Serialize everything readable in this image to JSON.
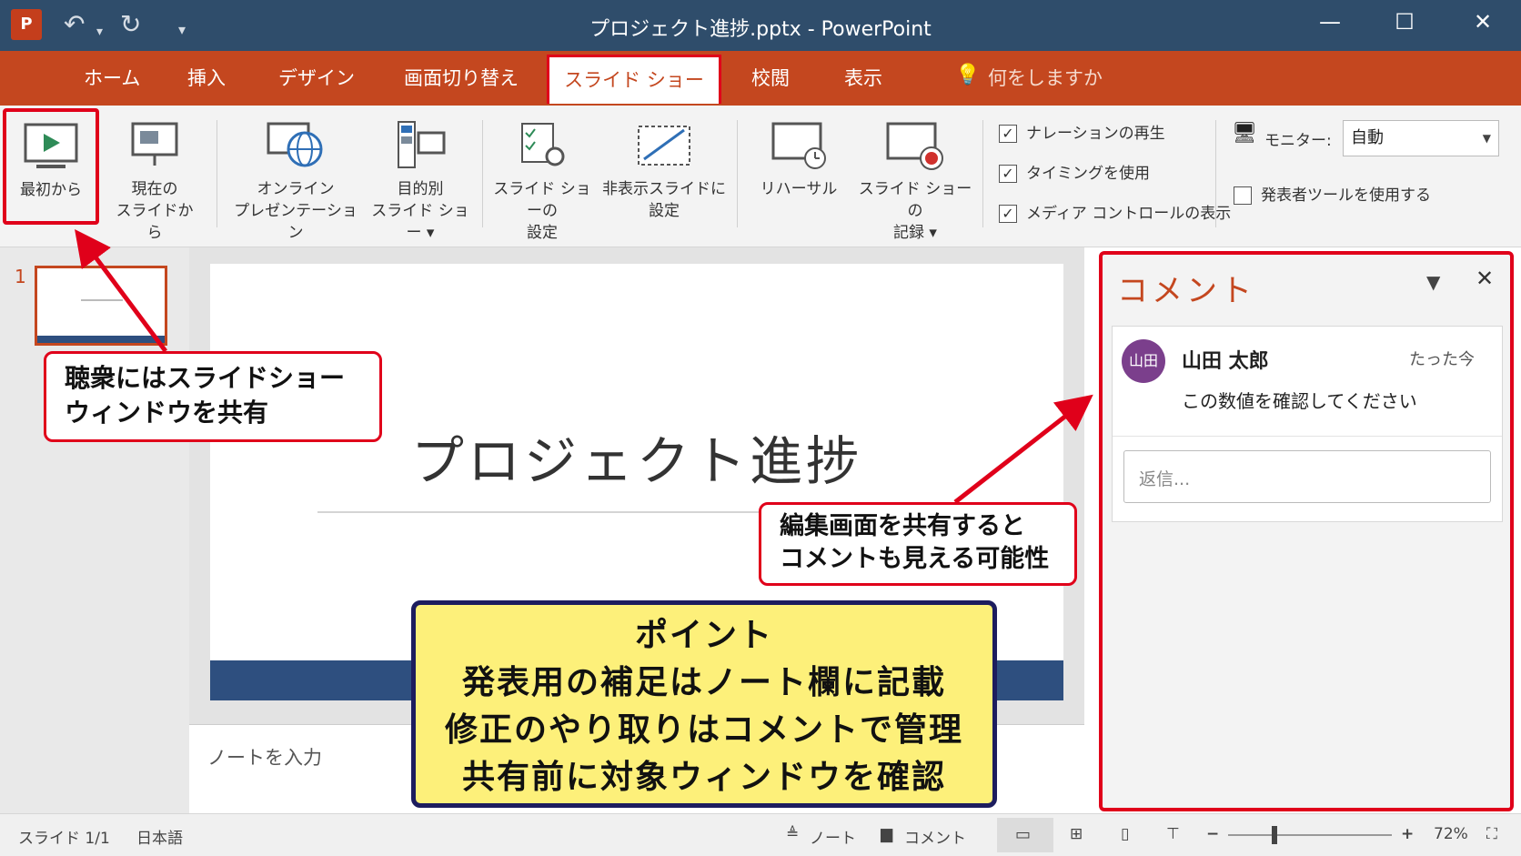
{
  "titlebar": {
    "app_logo": "P",
    "title": "プロジェクト進捗.pptx  -  PowerPoint"
  },
  "tabs": {
    "home": "ホーム",
    "insert": "挿入",
    "design": "デザイン",
    "transitions": "画面切り替え",
    "slideshow": "スライド ショー",
    "review": "校閲",
    "view": "表示",
    "tell_me": "何をしますか"
  },
  "ribbon": {
    "from_beginning": "最初から",
    "from_current_1": "現在の",
    "from_current_2": "スライドから",
    "online_1": "オンライン",
    "online_2": "プレゼンテーション",
    "custom_1": "目的別",
    "custom_2": "スライド ショー ▾",
    "setup_1": "スライド ショーの",
    "setup_2": "設定",
    "hide_1": "非表示スライドに",
    "hide_2": "設定",
    "rehearse": "リハーサル",
    "record_1": "スライド ショーの",
    "record_2": "記録 ▾",
    "play_narrations": "ナレーションの再生",
    "use_timings": "タイミングを使用",
    "show_media_controls": "メディア コントロールの表示",
    "monitor_label": "モニター:",
    "monitor_value": "自動",
    "presenter_view": "発表者ツールを使用する"
  },
  "thumbnail": {
    "number": "1"
  },
  "slide": {
    "title": "プロジェクト進捗"
  },
  "notes": {
    "placeholder": "ノートを入力"
  },
  "comments": {
    "pane_title": "コメント",
    "avatar_initials": "山田",
    "author": "山田 太郎",
    "time": "たった今",
    "text": "この数値を確認してください",
    "reply_placeholder": "返信..."
  },
  "statusbar": {
    "slide_count": "スライド 1/1",
    "language": "日本語",
    "notes_button": "ノート",
    "comments_button": "コメント",
    "zoom": "72%"
  },
  "callouts": {
    "audience_1": "聴衆にはスライドショー",
    "audience_2": "ウィンドウを共有",
    "comments_1": "編集画面を共有すると",
    "comments_2": "コメントも見える可能性",
    "point_title": "ポイント",
    "point_1": "発表用の補足はノート欄に記載",
    "point_2": "修正のやり取りはコメントで管理",
    "point_3": "共有前に対象ウィンドウを確認"
  },
  "colors": {
    "titlebar": "#2f4d6b",
    "ribbon_tab_bar": "#c4471f",
    "highlight_red": "#e0001a",
    "point_yellow": "#fdf07a",
    "slide_bar": "#2e4f7f",
    "avatar": "#7b3f8c"
  }
}
